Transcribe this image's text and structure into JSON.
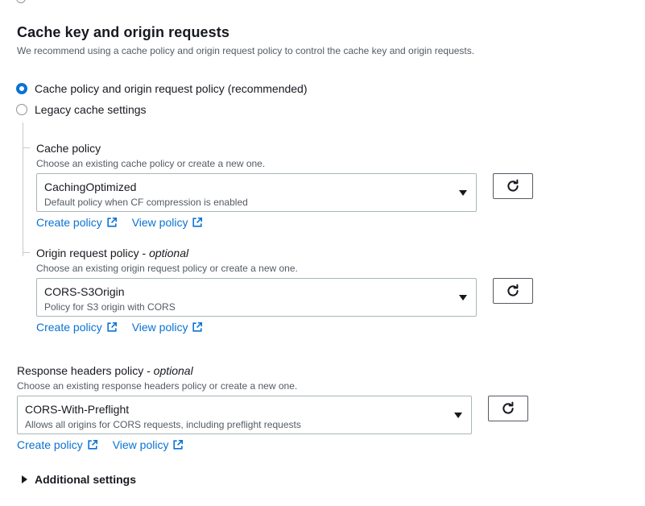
{
  "section": {
    "title": "Cache key and origin requests",
    "description": "We recommend using a cache policy and origin request policy to control the cache key and origin requests."
  },
  "radios": [
    {
      "label": "Cache policy and origin request policy (recommended)",
      "checked": true
    },
    {
      "label": "Legacy cache settings",
      "checked": false
    }
  ],
  "cache_policy": {
    "label": "Cache policy",
    "description": "Choose an existing cache policy or create a new one.",
    "selected_value": "CachingOptimized",
    "selected_description": "Default policy when CF compression is enabled",
    "create_link": "Create policy",
    "view_link": "View policy"
  },
  "origin_request_policy": {
    "label": "Origin request policy - ",
    "label_optional": "optional",
    "description": "Choose an existing origin request policy or create a new one.",
    "selected_value": "CORS-S3Origin",
    "selected_description": "Policy for S3 origin with CORS",
    "create_link": "Create policy",
    "view_link": "View policy"
  },
  "response_headers_policy": {
    "label": "Response headers policy - ",
    "label_optional": "optional",
    "description": "Choose an existing response headers policy or create a new one.",
    "selected_value": "CORS-With-Preflight",
    "selected_description": "Allows all origins for CORS requests, including preflight requests",
    "create_link": "Create policy",
    "view_link": "View policy"
  },
  "additional_settings": {
    "label": "Additional settings"
  },
  "icons": {
    "refresh": "refresh-icon",
    "external_link": "external-link-icon",
    "dropdown": "caret-down-icon",
    "expand": "caret-right-icon"
  },
  "colors": {
    "link": "#0972d3",
    "radio_selected": "#0972d3",
    "text": "#16191f",
    "secondary_text": "#545b64"
  }
}
